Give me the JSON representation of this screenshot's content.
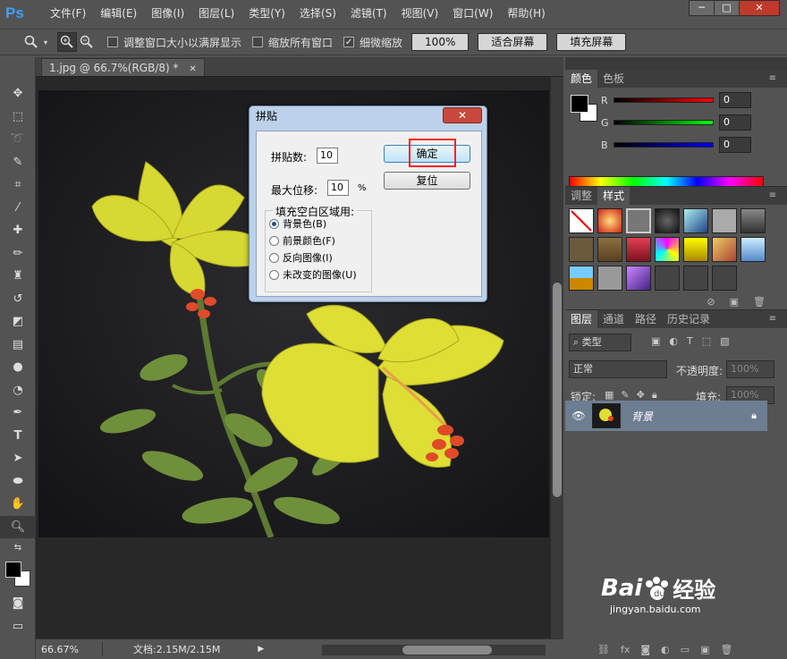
{
  "app": {
    "logo": "Ps"
  },
  "menu": [
    "文件(F)",
    "编辑(E)",
    "图像(I)",
    "图层(L)",
    "类型(Y)",
    "选择(S)",
    "滤镜(T)",
    "视图(V)",
    "窗口(W)",
    "帮助(H)"
  ],
  "options": {
    "resize_windows": "调整窗口大小以满屏显示",
    "zoom_all": "缩放所有窗口",
    "scrubby_zoom": "细微缩放",
    "btn_100": "100%",
    "btn_fit": "适合屏幕",
    "btn_fill": "填充屏幕"
  },
  "document": {
    "tab_title": "1.jpg @ 66.7%(RGB/8) *",
    "zoom": "66.67%",
    "doc_size": "文档:2.15M/2.15M"
  },
  "dialog": {
    "title": "拼贴",
    "tiles_label": "拼贴数:",
    "tiles_value": "10",
    "offset_label": "最大位移:",
    "offset_value": "10",
    "offset_unit": "%",
    "ok": "确定",
    "reset": "复位",
    "fill_group": "填充空白区域用:",
    "options": [
      "背景色(B)",
      "前景颜色(F)",
      "反向图像(I)",
      "未改变的图像(U)"
    ],
    "selected": 0
  },
  "color_panel": {
    "tabs": [
      "颜色",
      "色板"
    ],
    "channels": [
      {
        "label": "R",
        "value": "0",
        "color": "#ff0000"
      },
      {
        "label": "G",
        "value": "0",
        "color": "#00ff00"
      },
      {
        "label": "B",
        "value": "0",
        "color": "#0000ff"
      }
    ]
  },
  "styles_panel": {
    "tabs": [
      "调整",
      "样式"
    ]
  },
  "layers_panel": {
    "tabs": [
      "图层",
      "通道",
      "路径",
      "历史记录"
    ],
    "filter_type": "类型",
    "blend_mode": "正常",
    "opacity_label": "不透明度:",
    "opacity_value": "100%",
    "lock_label": "锁定:",
    "fill_label": "填充:",
    "fill_value": "100%",
    "layer_name": "背景"
  },
  "watermark": {
    "brand": "Bai",
    "brand2": "经验",
    "url": "jingyan.baidu.com"
  }
}
